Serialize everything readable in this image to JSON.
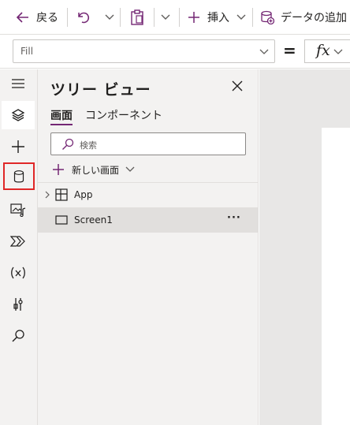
{
  "toolbar": {
    "back_label": "戻る",
    "insert_label": "挿入",
    "add_data_label": "データの追加",
    "icons": [
      "back-arrow-icon",
      "undo-icon",
      "chevron-down-icon",
      "paste-icon",
      "chevron-down-icon",
      "plus-icon",
      "chevron-down-icon",
      "add-data-icon"
    ]
  },
  "formula_bar": {
    "property": "Fill",
    "equals": "=",
    "fx_label": "fx"
  },
  "rail": {
    "items": [
      "hamburger-icon",
      "layers-icon",
      "insert-icon",
      "data-icon",
      "media-icon",
      "power-automate-icon",
      "variables-icon",
      "tools-icon",
      "search-icon"
    ],
    "active": "layers-icon",
    "highlighted": "data-icon"
  },
  "tree_panel": {
    "title": "ツリー ビュー",
    "tabs": [
      "画面",
      "コンポーネント"
    ],
    "active_tab": "画面",
    "search_placeholder": "検索",
    "new_screen_label": "新しい画面",
    "items": [
      {
        "label": "App",
        "icon": "app-icon",
        "expandable": true,
        "selected": false
      },
      {
        "label": "Screen1",
        "icon": "screen-icon",
        "expandable": false,
        "selected": true,
        "more": "···"
      }
    ]
  },
  "colors": {
    "accent": "#742774",
    "highlight_border": "#e02727",
    "panel_bg": "#f3f2f1",
    "selected_row": "#e1dfdd"
  }
}
